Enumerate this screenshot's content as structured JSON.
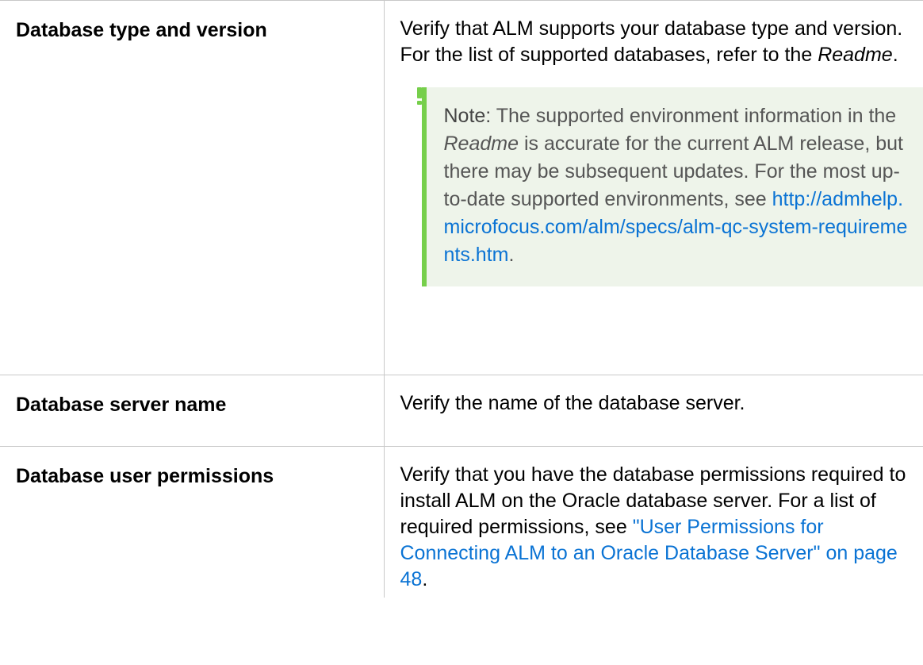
{
  "rows": [
    {
      "term": "Database type and version",
      "desc_part1": "Verify that ALM supports your database type and version. For the list of supported databases, refer to the ",
      "desc_emph": "Readme",
      "desc_part2": ".",
      "note": {
        "label": "Note:",
        "text_part1": " The supported environment information in the ",
        "text_emph": "Readme",
        "text_part2": " is accurate for the current ALM release, but there may be subsequent updates. For the most up-to-date supported environments, see ",
        "link_text": "http://admhelp.microfocus.com/alm/specs/alm-qc-system-requirements.htm",
        "text_end": ".",
        "icon": "exclamation-icon",
        "accent_color": "#76cf4b"
      }
    },
    {
      "term": "Database server name",
      "desc": "Verify the name of the database server."
    },
    {
      "term": "Database user permissions",
      "desc_part1": "Verify that you have the database permissions required to install ALM on the Oracle database server. For a list of required permissions, see ",
      "link_text": "\"User Permissions for Connecting ALM to an Oracle Database Server\" on page 48",
      "desc_end": "."
    }
  ],
  "colors": {
    "link": "#0a73d4",
    "note_background": "#eef4ea",
    "border": "#c8c8c8"
  }
}
